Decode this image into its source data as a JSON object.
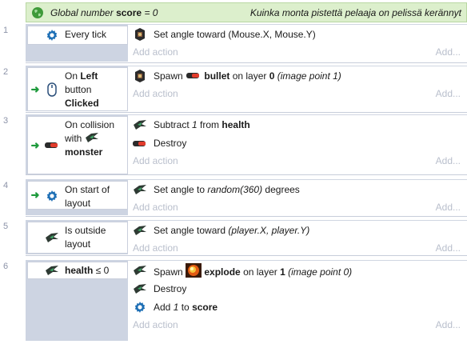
{
  "global_var": {
    "prefix": "Global number",
    "name": "score",
    "suffix": "= 0",
    "comment": "Kuinka monta pistettä pelaaja on pelissä kerännyt"
  },
  "add_action_label": "Add action",
  "add_dots_label": "Add...",
  "events": [
    {
      "number": "1",
      "condition": {
        "icon": "gear-icon",
        "text": "Every tick",
        "has_arrow": false
      },
      "actions": [
        {
          "icon": "player-ship-icon",
          "text": "Set angle toward (Mouse.X, Mouse.Y)"
        }
      ]
    },
    {
      "number": "2",
      "condition": {
        "icon": "mouse-icon",
        "text": "On Left button Clicked",
        "has_arrow": true
      },
      "actions": [
        {
          "icon": "player-ship-icon",
          "text": "Spawn bullet on layer 0 (image point 1)"
        }
      ]
    },
    {
      "number": "3",
      "condition": {
        "icon": "bullet-icon",
        "text": "On collision with monster",
        "has_arrow": true
      },
      "actions": [
        {
          "icon": "monster-icon",
          "text": "Subtract 1 from health"
        },
        {
          "icon": "bullet-icon",
          "text": "Destroy"
        }
      ]
    },
    {
      "number": "4",
      "condition": {
        "icon": "gear-icon",
        "text": "On start of layout",
        "has_arrow": true
      },
      "actions": [
        {
          "icon": "monster-icon",
          "text": "Set angle to random(360) degrees"
        }
      ]
    },
    {
      "number": "5",
      "condition": {
        "icon": "monster-icon",
        "text": "Is outside layout",
        "has_arrow": false
      },
      "actions": [
        {
          "icon": "monster-icon",
          "text": "Set angle toward (player.X, player.Y)"
        }
      ]
    },
    {
      "number": "6",
      "condition": {
        "icon": "monster-icon",
        "text": "health ≤ 0",
        "has_arrow": false
      },
      "actions": [
        {
          "icon": "monster-icon",
          "text": "Spawn explode on layer 1 (image point 0)"
        },
        {
          "icon": "monster-icon",
          "text": "Destroy"
        },
        {
          "icon": "gear-icon",
          "text": "Add 1 to score"
        }
      ]
    }
  ]
}
